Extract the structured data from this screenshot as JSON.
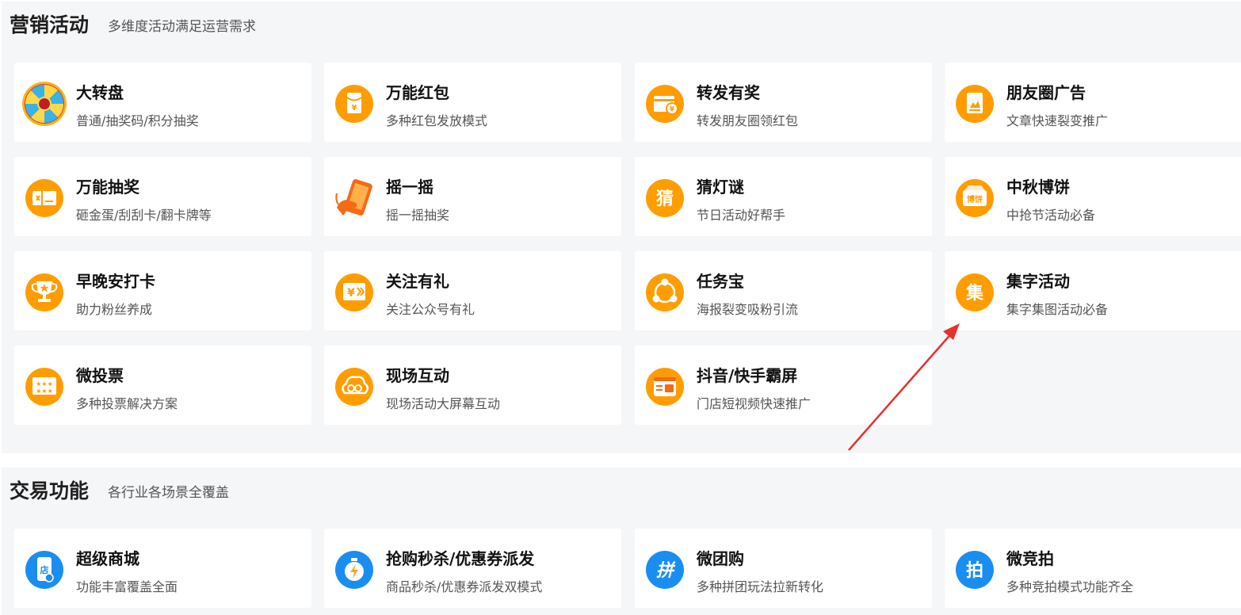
{
  "marketing": {
    "title": "营销活动",
    "subtitle": "多维度活动满足运营需求",
    "items": [
      {
        "title": "大转盘",
        "desc": "普通/抽奖码/积分抽奖",
        "icon": "wheel-icon"
      },
      {
        "title": "万能红包",
        "desc": "多种红包发放模式",
        "icon": "red-packet-icon"
      },
      {
        "title": "转发有奖",
        "desc": "转发朋友圈领红包",
        "icon": "share-reward-icon"
      },
      {
        "title": "朋友圈广告",
        "desc": "文章快速裂变推广",
        "icon": "moments-ad-icon"
      },
      {
        "title": "万能抽奖",
        "desc": "砸金蛋/刮刮卡/翻卡牌等",
        "icon": "lottery-icon"
      },
      {
        "title": "摇一摇",
        "desc": "摇一摇抽奖",
        "icon": "shake-phone-icon"
      },
      {
        "title": "猜灯谜",
        "desc": "节日活动好帮手",
        "icon": "riddle-icon",
        "glyph": "猜"
      },
      {
        "title": "中秋博饼",
        "desc": "中抢节活动必备",
        "icon": "mooncake-icon",
        "glyph": "博饼"
      },
      {
        "title": "早晚安打卡",
        "desc": "助力粉丝养成",
        "icon": "trophy-icon"
      },
      {
        "title": "关注有礼",
        "desc": "关注公众号有礼",
        "icon": "follow-gift-icon",
        "glyph": "¥"
      },
      {
        "title": "任务宝",
        "desc": "海报裂变吸粉引流",
        "icon": "task-share-icon"
      },
      {
        "title": "集字活动",
        "desc": "集字集图活动必备",
        "icon": "collect-word-icon",
        "glyph": "集"
      },
      {
        "title": "微投票",
        "desc": "多种投票解决方案",
        "icon": "vote-icon",
        "glyph": "★★★"
      },
      {
        "title": "现场互动",
        "desc": "现场活动大屏幕互动",
        "icon": "live-interact-icon"
      },
      {
        "title": "抖音/快手霸屏",
        "desc": "门店短视频快速推广",
        "icon": "short-video-icon"
      }
    ]
  },
  "trade": {
    "title": "交易功能",
    "subtitle": "各行业各场景全覆盖",
    "items": [
      {
        "title": "超级商城",
        "desc": "功能丰富覆盖全面",
        "icon": "store-phone-icon",
        "glyph": "店"
      },
      {
        "title": "抢购秒杀/优惠券派发",
        "desc": "商品秒杀/优惠券派发双模式",
        "icon": "flash-sale-icon"
      },
      {
        "title": "微团购",
        "desc": "多种拼团玩法拉新转化",
        "icon": "group-buy-icon",
        "glyph": "拼"
      },
      {
        "title": "微竞拍",
        "desc": "多种竞拍模式功能齐全",
        "icon": "auction-icon",
        "glyph": "拍"
      }
    ]
  },
  "colors": {
    "orange": "#ff9d00",
    "blue": "#1a8ef0",
    "arrow": "#e8312f"
  }
}
